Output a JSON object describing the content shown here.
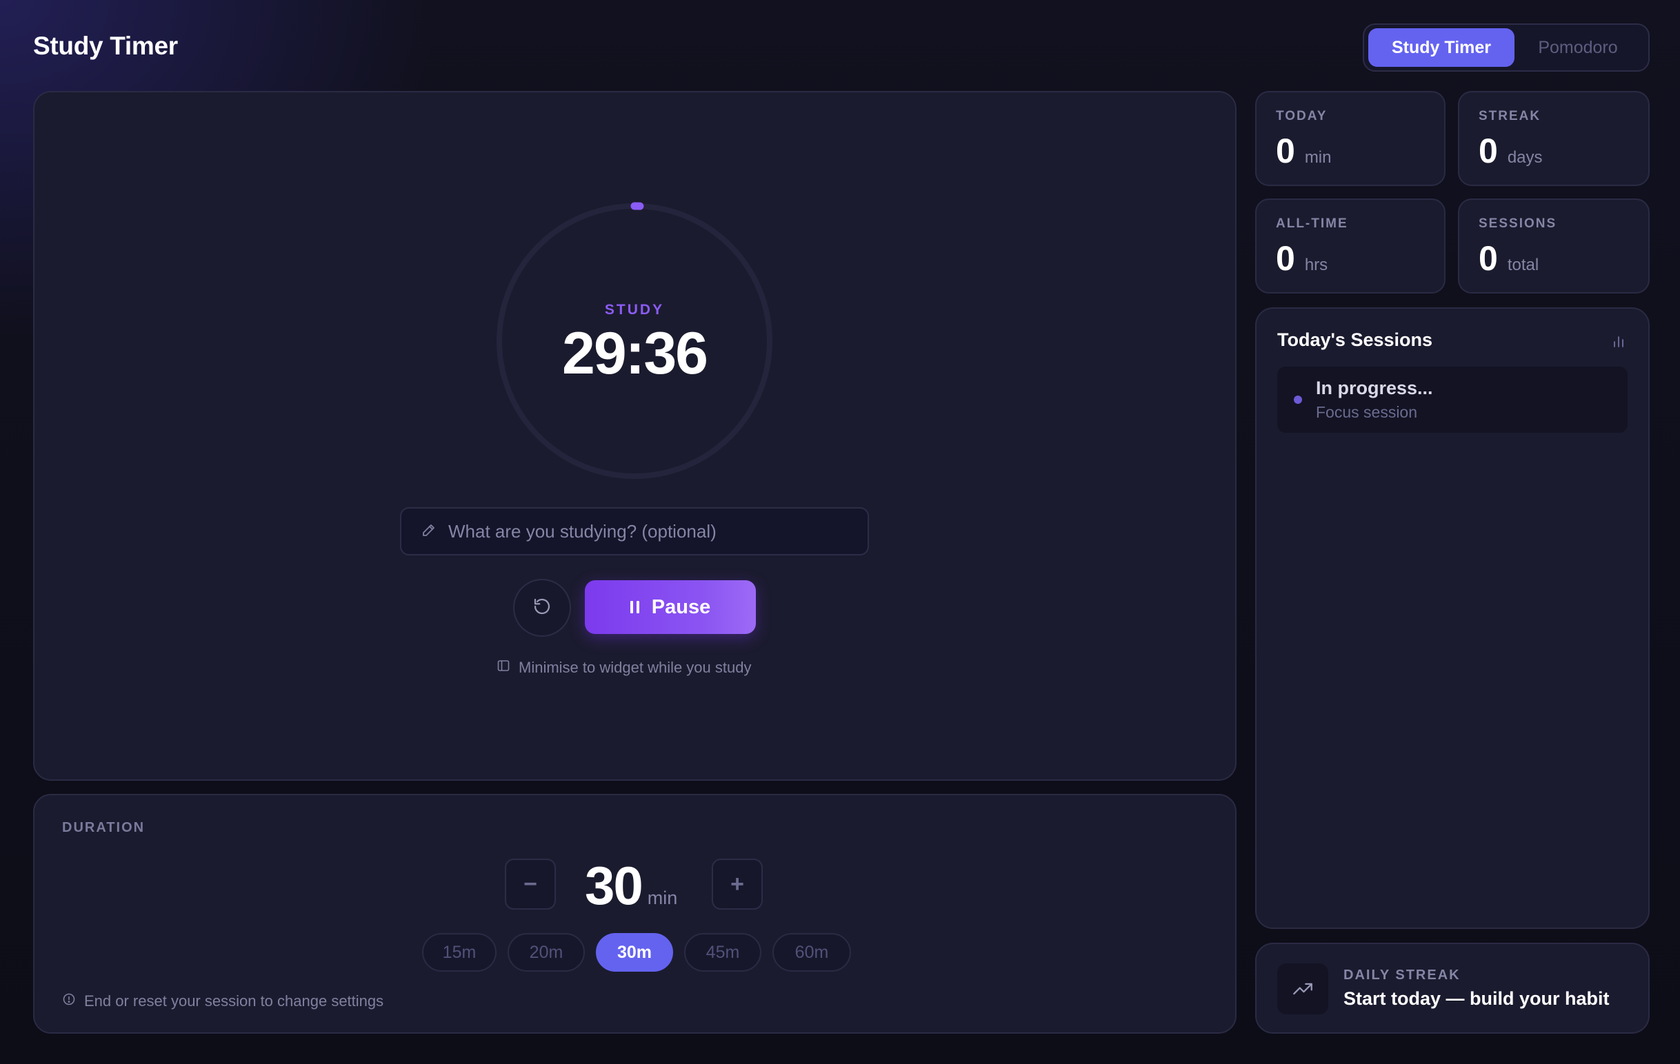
{
  "app": {
    "title": "Study Timer"
  },
  "mode_switch": {
    "active": "Study Timer",
    "inactive": "Pomodoro"
  },
  "timer": {
    "mode_label": "STUDY",
    "time_display": "29:36",
    "progress_fraction": 0.013,
    "ring_color": "#8b5cf6",
    "track_color": "#24243c"
  },
  "study_input": {
    "placeholder": "What are you studying? (optional)",
    "value": ""
  },
  "controls": {
    "pause_label": "Pause",
    "minimise_hint": "Minimise to widget while you study"
  },
  "duration": {
    "label": "DURATION",
    "value": "30",
    "unit": "min",
    "minus_label": "−",
    "plus_label": "+",
    "presets": [
      "15m",
      "20m",
      "30m",
      "45m",
      "60m"
    ],
    "selected_preset": "30m",
    "note": "End or reset your session to change settings"
  },
  "stats": {
    "today": {
      "label": "TODAY",
      "value": "0",
      "unit": "min"
    },
    "streak": {
      "label": "STREAK",
      "value": "0",
      "unit": "days"
    },
    "alltime": {
      "label": "ALL-TIME",
      "value": "0",
      "unit": "hrs"
    },
    "sessions": {
      "label": "SESSIONS",
      "value": "0",
      "unit": "total"
    }
  },
  "todays_sessions": {
    "title": "Today's Sessions",
    "items": [
      {
        "title": "In progress...",
        "subtitle": "Focus session"
      }
    ]
  },
  "daily_streak": {
    "label": "DAILY STREAK",
    "message": "Start today — build your habit"
  },
  "colors": {
    "accent": "#6463f0",
    "primary_purple": "#7c3aed",
    "panel": "#1b1b2f"
  }
}
